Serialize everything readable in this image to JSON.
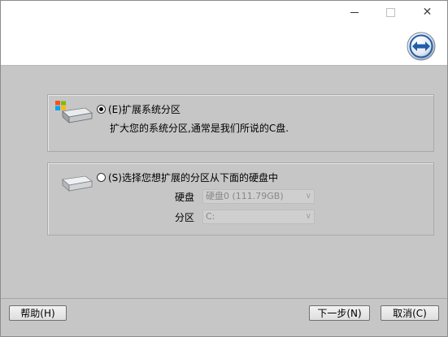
{
  "window": {
    "controls": {
      "minimize": "minimize-icon",
      "maximize": "maximize-icon",
      "close": "✕"
    }
  },
  "header": {
    "logo_icon": "double-arrow-logo-icon",
    "accent": "#1f5fa8"
  },
  "options": [
    {
      "id": "expand-system",
      "label": "(E)扩展系统分区",
      "description": "扩大您的系统分区,通常是我们所说的C盘.",
      "selected": true,
      "icon": "windows-drive-icon"
    },
    {
      "id": "select-partition",
      "label": "(S)选择您想扩展的分区从下面的硬盘中",
      "selected": false,
      "icon": "drive-icon",
      "fields": [
        {
          "label": "硬盘",
          "value": "硬盘0 (111.79GB)"
        },
        {
          "label": "分区",
          "value": "C:"
        }
      ]
    }
  ],
  "footer": {
    "help": "帮助(H)",
    "next": "下一步(N)",
    "cancel": "取消(C)"
  }
}
